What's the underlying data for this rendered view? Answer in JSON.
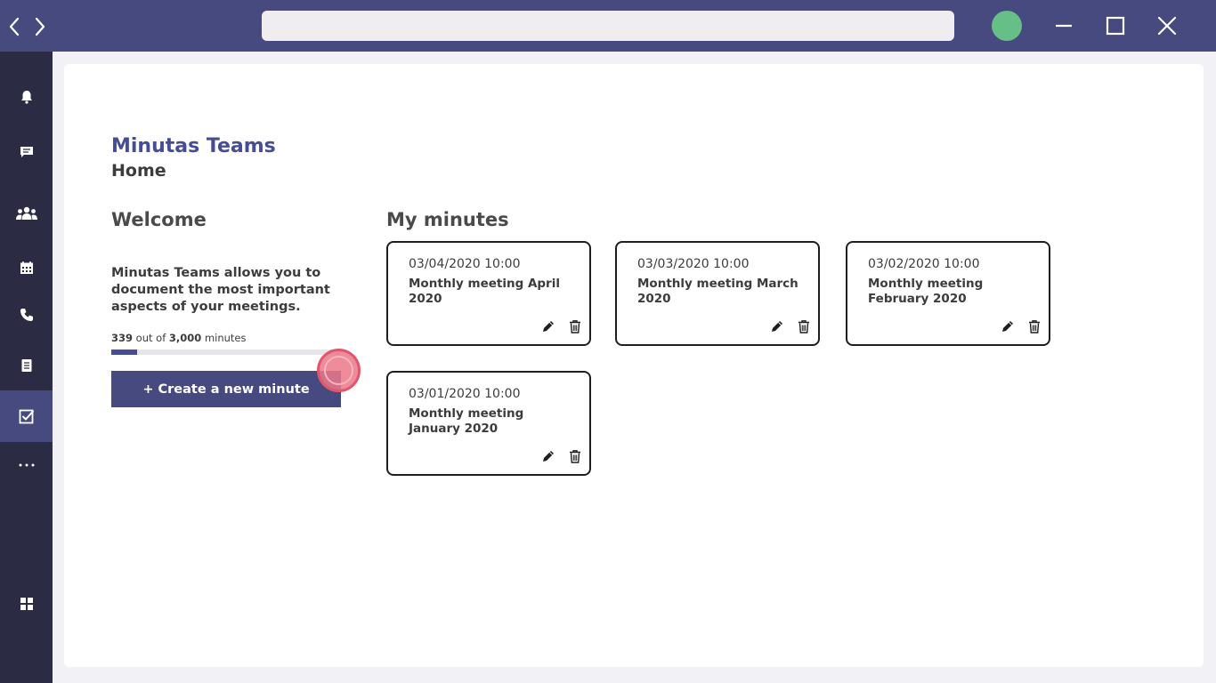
{
  "window": {
    "search": {
      "value": "",
      "placeholder": ""
    },
    "avatar_color": "#66bf87"
  },
  "sidebar": {
    "items": [
      {
        "icon": "bell-icon",
        "name": "sidebar-item-activity",
        "active": false
      },
      {
        "icon": "chat-icon",
        "name": "sidebar-item-chat",
        "active": false
      },
      {
        "icon": "teams-icon",
        "name": "sidebar-item-teams",
        "active": false
      },
      {
        "icon": "calendar-icon",
        "name": "sidebar-item-calendar",
        "active": false
      },
      {
        "icon": "phone-icon",
        "name": "sidebar-item-calls",
        "active": false
      },
      {
        "icon": "document-icon",
        "name": "sidebar-item-files",
        "active": false
      },
      {
        "icon": "checkbox-icon",
        "name": "sidebar-item-minutas",
        "active": true
      },
      {
        "icon": "more-icon",
        "name": "sidebar-item-more",
        "active": false
      },
      {
        "icon": "apps-icon",
        "name": "sidebar-item-apps",
        "active": false
      }
    ]
  },
  "header": {
    "app_title": "Minutas Teams",
    "subtitle": "Home"
  },
  "welcome": {
    "title": "Welcome",
    "description": "Minutas Teams allows you to document the most important aspects of your meetings.",
    "usage": {
      "used": "339",
      "connector": "out of",
      "total": "3,000",
      "unit": "minutes",
      "used_fraction": 0.113
    },
    "create_button_label": "+ Create a new minute"
  },
  "minutes": {
    "title": "My minutes",
    "cards": [
      {
        "date": "03/04/2020 10:00",
        "title": "Monthly meeting April 2020"
      },
      {
        "date": "03/03/2020 10:00",
        "title": "Monthly meeting March 2020"
      },
      {
        "date": "03/02/2020 10:00",
        "title": "Monthly meeting February 2020"
      },
      {
        "date": "03/01/2020 10:00",
        "title": "Monthly meeting January 2020"
      }
    ]
  },
  "colors": {
    "brand": "#474d94",
    "topbar": "#464a7e",
    "sidebar": "#2b2b44",
    "cursor": "#e0576d"
  }
}
